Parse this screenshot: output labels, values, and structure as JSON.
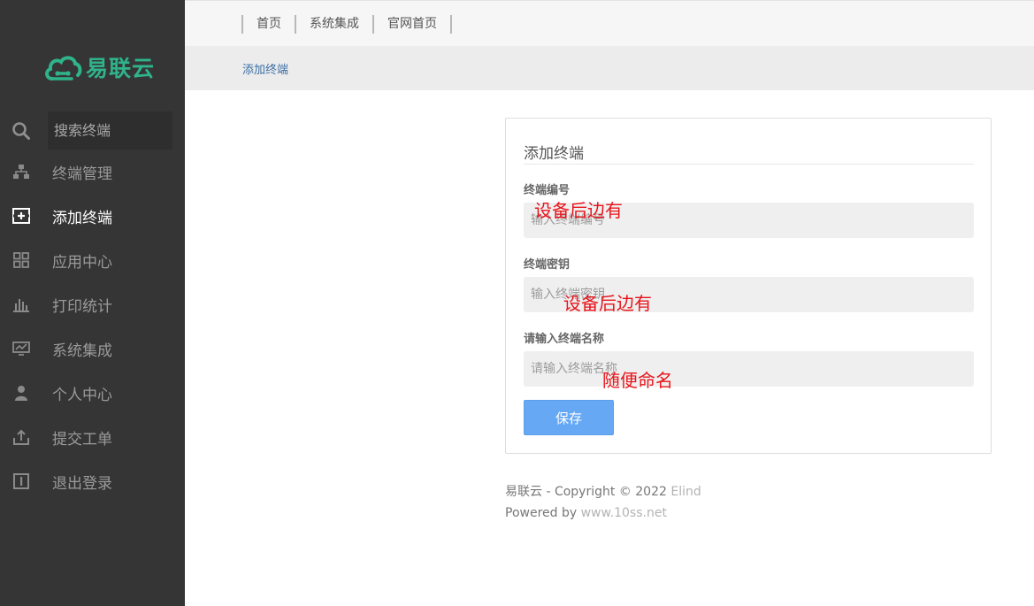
{
  "brand": {
    "name": "易联云",
    "color": "#2fb38a"
  },
  "search": {
    "placeholder": "搜索终端"
  },
  "sidebar": {
    "items": [
      {
        "label": "终端管理",
        "icon": "sitemap-icon"
      },
      {
        "label": "添加终端",
        "icon": "add-box-icon",
        "active": true
      },
      {
        "label": "应用中心",
        "icon": "grid-icon"
      },
      {
        "label": "打印统计",
        "icon": "bar-chart-icon"
      },
      {
        "label": "系统集成",
        "icon": "monitor-chart-icon"
      },
      {
        "label": "个人中心",
        "icon": "user-icon"
      },
      {
        "label": "提交工单",
        "icon": "upload-icon"
      },
      {
        "label": "退出登录",
        "icon": "logout-icon"
      }
    ]
  },
  "topnav": {
    "items": [
      "首页",
      "系统集成",
      "官网首页"
    ]
  },
  "breadcrumb": {
    "current": "添加终端"
  },
  "form": {
    "title": "添加终端",
    "fields": [
      {
        "label": "终端编号",
        "placeholder": "输入终端编号",
        "annotation": "设备后边有"
      },
      {
        "label": "终端密钥",
        "placeholder": "输入终端密钥",
        "annotation": "设备后边有"
      },
      {
        "label": "请输入终端名称",
        "placeholder": "请输入终端名称",
        "annotation": "随便命名"
      }
    ],
    "save_label": "保存"
  },
  "footer": {
    "line1_prefix": "易联云 - Copyright © 2022 ",
    "line1_link": "Elind",
    "line2_prefix": "Powered by ",
    "line2_link": "www.10ss.net"
  },
  "colors": {
    "sidebar_bg": "#353535",
    "accent": "#2fb38a",
    "button": "#66a8f4",
    "annotation": "#e8141b"
  }
}
